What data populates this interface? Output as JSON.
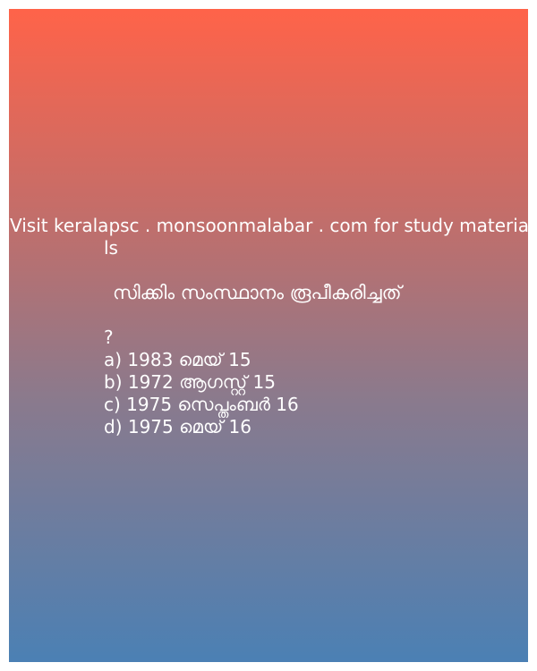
{
  "header": {
    "line1": "Visit keralapsc . monsoonmalabar . com for study materia",
    "line2": "ls"
  },
  "question": {
    "text": "സിക്കിം സംസ്ഥാനം രൂപീകരിച്ചത്",
    "mark": "?"
  },
  "options": [
    "a) 1983 മെയ് 15",
    "b) 1972 ആഗസ്റ്റ് 15",
    "c) 1975 സെപ്തംബർ 16",
    "d) 1975 മെയ് 16"
  ],
  "colors": {
    "gradient_top": "#ff6349",
    "gradient_bottom": "#4b80b4",
    "text": "#ffffff"
  }
}
